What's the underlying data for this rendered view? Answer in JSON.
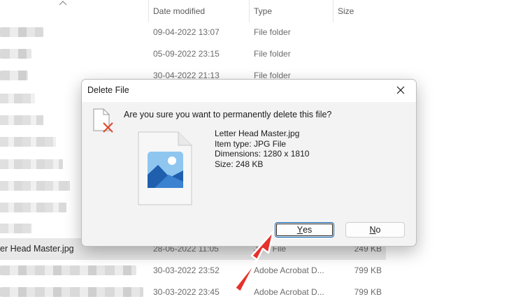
{
  "explorer": {
    "columns": {
      "date": "Date modified",
      "type": "Type",
      "size": "Size"
    },
    "rows": [
      {
        "name": "",
        "date": "09-04-2022 13:07",
        "type": "File folder",
        "size": ""
      },
      {
        "name": "",
        "date": "05-09-2022 23:15",
        "type": "File folder",
        "size": ""
      },
      {
        "name": "",
        "date": "30-04-2022 21:13",
        "type": "File folder",
        "size": ""
      },
      {
        "name": "er Head Master.jpg",
        "date": "28-06-2022 11:05",
        "type": "JPG File",
        "size": "249 KB"
      },
      {
        "name": "",
        "date": "30-03-2022 23:52",
        "type": "Adobe Acrobat D...",
        "size": "799 KB"
      },
      {
        "name": "",
        "date": "30-03-2022 23:45",
        "type": "Adobe Acrobat D...",
        "size": "799 KB"
      }
    ]
  },
  "dialog": {
    "title": "Delete File",
    "question": "Are you sure you want to permanently delete this file?",
    "file_name": "Letter Head Master.jpg",
    "item_type": "Item type: JPG File",
    "dimensions": "Dimensions: 1280 x 1810",
    "size": "Size: 248 KB",
    "yes_mnemonic": "Y",
    "yes_rest": "es",
    "no_mnemonic": "N",
    "no_rest": "o"
  },
  "icons": {
    "close": "close-icon",
    "delete_file": "file-delete-icon",
    "image_file": "image-file-icon",
    "annotation": "red-arrow"
  },
  "colors": {
    "accent": "#005fb8",
    "annotation_red": "#e5322d"
  }
}
